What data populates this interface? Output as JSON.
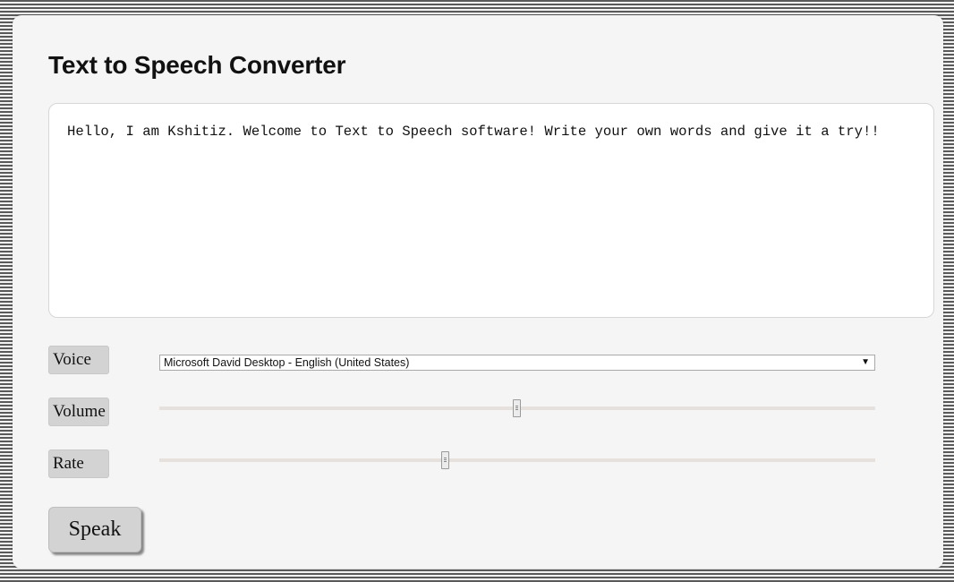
{
  "app": {
    "title": "Text to Speech Converter"
  },
  "text_input": {
    "value": "Hello, I am Kshitiz. Welcome to Text to Speech software! Write your own words and give it a try!!"
  },
  "controls": {
    "voice": {
      "label": "Voice",
      "selected": "Microsoft David Desktop - English (United States)"
    },
    "volume": {
      "label": "Volume",
      "value_fraction": 0.5
    },
    "rate": {
      "label": "Rate",
      "value_fraction": 0.4
    }
  },
  "speak_button": {
    "label": "Speak"
  },
  "icons": {
    "dropdown_arrow": "▼"
  },
  "colors": {
    "card_background": "#f5f5f5",
    "label_background": "#d3d3d3",
    "track": "#e6e1dc"
  }
}
